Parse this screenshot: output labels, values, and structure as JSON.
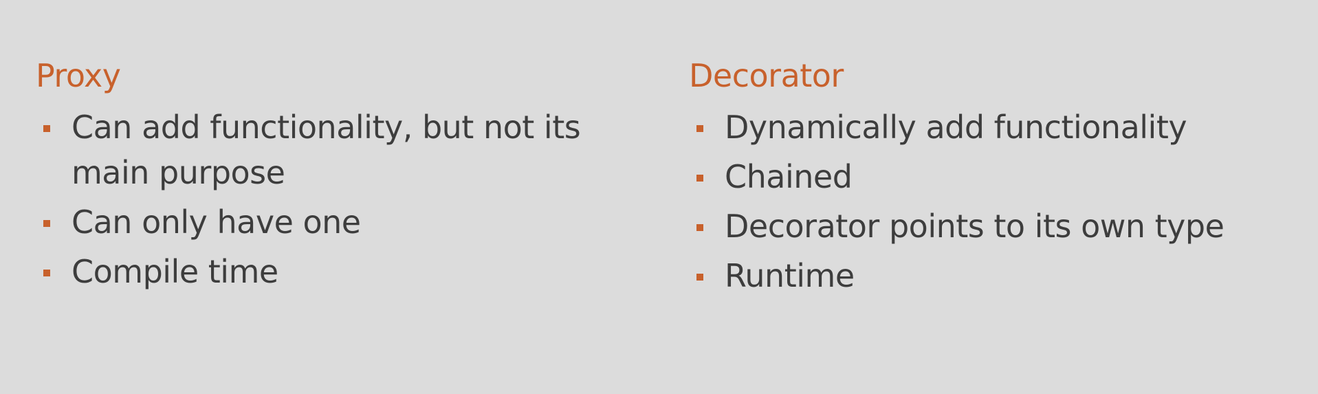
{
  "left": {
    "title": "Proxy",
    "items": [
      "Can add functionality, but not its main purpose",
      "Can only have one",
      "Compile time"
    ]
  },
  "right": {
    "title": "Decorator",
    "items": [
      "Dynamically add functionality",
      "Chained",
      "Decorator points to its own type",
      "Runtime"
    ]
  },
  "colors": {
    "background": "#dcdcdc",
    "accent": "#c8612c",
    "text": "#3d3d3d"
  }
}
